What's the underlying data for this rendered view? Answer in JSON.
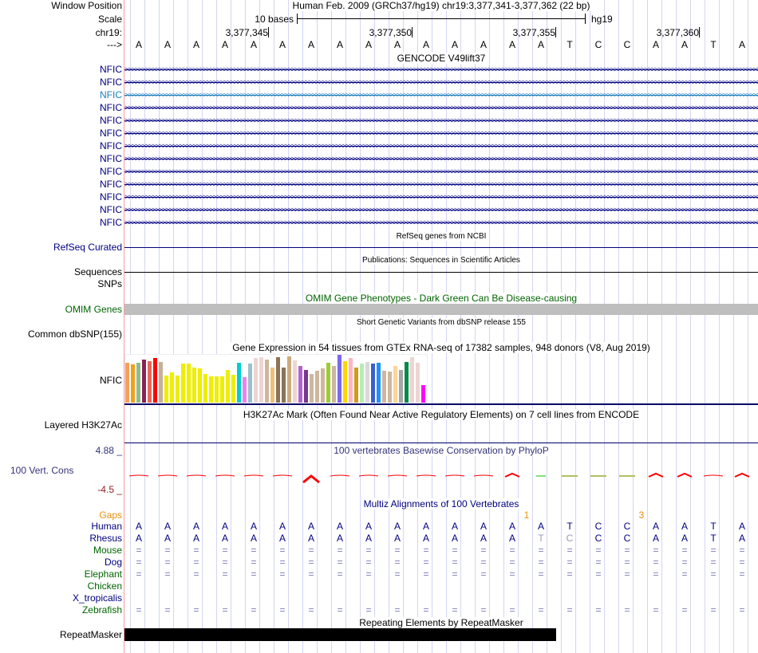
{
  "header": {
    "window_position_label": "Window Position",
    "position_text": "Human Feb. 2009 (GRCh37/hg19)   chr19:3,377,341-3,377,362 (22 bp)",
    "scale_label": "Scale",
    "scale_text": "10 bases",
    "scale_assembly": "hg19",
    "chrom_label": "chr19:",
    "ticks": [
      "3,377,345",
      "3,377,350",
      "3,377,355",
      "3,377,360"
    ],
    "strand_label": "--->",
    "sequence": [
      "A",
      "A",
      "A",
      "A",
      "A",
      "A",
      "A",
      "A",
      "A",
      "A",
      "A",
      "A",
      "A",
      "A",
      "A",
      "T",
      "C",
      "C",
      "A",
      "A",
      "T",
      "A"
    ]
  },
  "gencode": {
    "title": "GENCODE V49lift37",
    "genes": [
      "NFIC",
      "NFIC",
      "NFIC",
      "NFIC",
      "NFIC",
      "NFIC",
      "NFIC",
      "NFIC",
      "NFIC",
      "NFIC",
      "NFIC",
      "NFIC",
      "NFIC"
    ]
  },
  "refseq": {
    "title": "RefSeq genes from NCBI",
    "label": "RefSeq Curated"
  },
  "publications": {
    "title": "Publications: Sequences in Scientific Articles",
    "label": "Sequences"
  },
  "snps": {
    "label": "SNPs"
  },
  "omim": {
    "title": "OMIM Gene Phenotypes - Dark Green Can Be Disease-causing",
    "label": "OMIM Genes"
  },
  "dbsnp": {
    "title": "Short Genetic Variants from dbSNP release 155",
    "label": "Common dbSNP(155)"
  },
  "gtex": {
    "title": "Gene Expression in 54 tissues from GTEx RNA-seq of 17382 samples, 948 donors (V8, Aug 2019)",
    "label": "NFIC",
    "values": [
      0.84,
      0.8,
      0.84,
      0.9,
      0.87,
      0.94,
      0.85,
      0.56,
      0.63,
      0.56,
      0.82,
      0.82,
      0.73,
      0.71,
      0.6,
      0.55,
      0.55,
      0.55,
      0.68,
      0.58,
      0.84,
      0.53,
      0.82,
      0.94,
      0.95,
      0.9,
      0.74,
      0.95,
      0.74,
      0.97,
      0.89,
      0.77,
      0.69,
      0.6,
      0.66,
      0.71,
      0.84,
      0.77,
      1.0,
      0.87,
      0.94,
      0.73,
      0.81,
      0.85,
      0.82,
      0.84,
      0.66,
      0.65,
      0.76,
      0.68,
      0.85,
      0.95,
      0.84,
      0.37
    ],
    "colors": [
      "#F5A05A",
      "#F0A020",
      "#8FBC8F",
      "#8B2252",
      "#E8675A",
      "#FF0000",
      "#C9AF98",
      "#EEEE00",
      "#EEEE00",
      "#EEEE00",
      "#EEEE00",
      "#EEEE00",
      "#EEEE00",
      "#EEEE00",
      "#EEEE00",
      "#EEEE00",
      "#EEEE00",
      "#EEEE00",
      "#EEEE00",
      "#EEEE00",
      "#00CED1",
      "#EE82EE",
      "#9AC0CD",
      "#EED5D2",
      "#EED5D2",
      "#CDB79E",
      "#EEC07B",
      "#8B7355",
      "#8B7355",
      "#CDAA7D",
      "#EED5D2",
      "#B462D0",
      "#7A378B",
      "#CDB79E",
      "#CDB79E",
      "#CDB79E",
      "#9ACD32",
      "#CDB79E",
      "#7B68EE",
      "#FFD700",
      "#FFB6C1",
      "#CD9B1D",
      "#B4EEB4",
      "#D9D9D9",
      "#3A5FCD",
      "#1E90FF",
      "#CDB79E",
      "#CDB79E",
      "#FFD39B",
      "#A6A6A6",
      "#008B45",
      "#EED5D2",
      "#EED5D2",
      "#FF00FF"
    ]
  },
  "h3k27ac": {
    "title": "H3K27Ac Mark (Often Found Near Active Regulatory Elements) on 7 cell lines from ENCODE",
    "label": "Layered H3K27Ac"
  },
  "phylop": {
    "title": "100 vertebrates Basewise Conservation by PhyloP",
    "label": "100 Vert. Cons",
    "max": "4.88 _",
    "min": "-4.5 _"
  },
  "multiz": {
    "title": "Multiz Alignments of 100 Vertebrates",
    "gaps_label": "Gaps",
    "gaps": [
      {
        "after_base": 13,
        "text": "1"
      },
      {
        "after_base": 17,
        "text": "3"
      }
    ],
    "species": [
      {
        "name": "Human",
        "color": "#000080",
        "row": [
          "A",
          "A",
          "A",
          "A",
          "A",
          "A",
          "A",
          "A",
          "A",
          "A",
          "A",
          "A",
          "A",
          "A",
          "A",
          "T",
          "C",
          "C",
          "A",
          "A",
          "T",
          "A"
        ]
      },
      {
        "name": "Rhesus",
        "color": "#000080",
        "row": [
          "A",
          "A",
          "A",
          "A",
          "A",
          "A",
          "A",
          "A",
          "A",
          "A",
          "A",
          "A",
          "A",
          "A",
          "T",
          "C",
          "C",
          "C",
          "A",
          "A",
          "T",
          "A"
        ]
      },
      {
        "name": "Mouse",
        "color": "#006400",
        "row": [
          "=",
          "=",
          "=",
          "=",
          "=",
          "=",
          "=",
          "=",
          "=",
          "=",
          "=",
          "=",
          "=",
          "=",
          "=",
          "=",
          "=",
          "=",
          "=",
          "=",
          "=",
          "="
        ]
      },
      {
        "name": "Dog",
        "color": "#000080",
        "row": [
          "=",
          "=",
          "=",
          "=",
          "=",
          "=",
          "=",
          "=",
          "=",
          "=",
          "=",
          "=",
          "=",
          "=",
          "=",
          "=",
          "=",
          "=",
          "=",
          "=",
          "=",
          "="
        ]
      },
      {
        "name": "Elephant",
        "color": "#006400",
        "row": [
          "=",
          "=",
          "=",
          "=",
          "=",
          "=",
          "=",
          "=",
          "=",
          "=",
          "=",
          "=",
          "=",
          "=",
          "=",
          "=",
          "=",
          "=",
          "=",
          "=",
          "=",
          "="
        ]
      },
      {
        "name": "Chicken",
        "color": "#006400",
        "row": []
      },
      {
        "name": "X_tropicalis",
        "color": "#000080",
        "row": []
      },
      {
        "name": "Zebrafish",
        "color": "#006400",
        "row": [
          "=",
          "=",
          "=",
          "=",
          "=",
          "=",
          "=",
          "=",
          "=",
          "=",
          "=",
          "=",
          "=",
          "=",
          "=",
          "=",
          "=",
          "=",
          "=",
          "=",
          "=",
          "="
        ]
      }
    ]
  },
  "repeatmasker": {
    "title": "Repeating Elements by RepeatMasker",
    "label": "RepeatMasker"
  }
}
